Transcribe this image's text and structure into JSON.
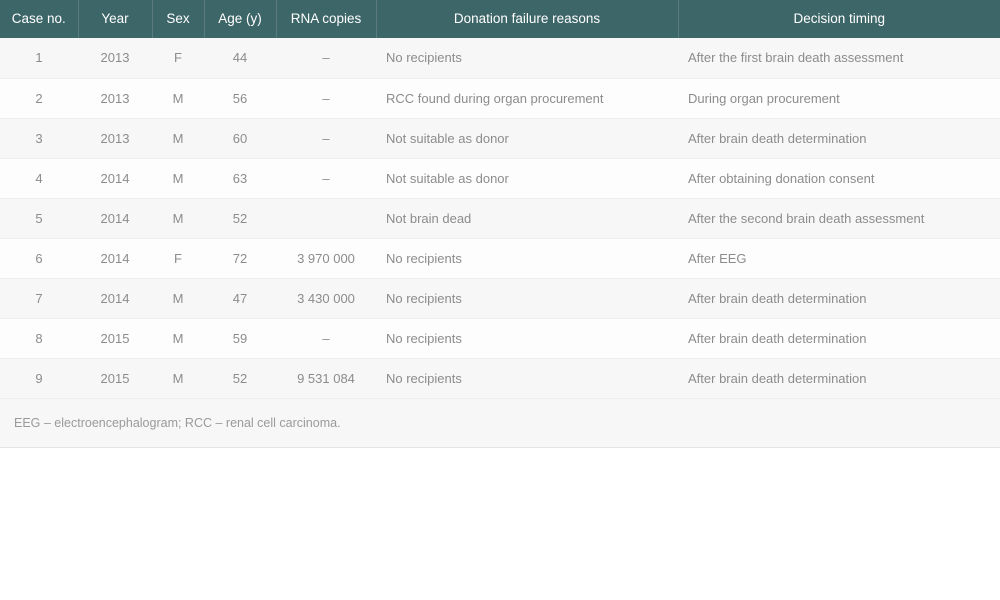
{
  "table": {
    "columns": [
      {
        "key": "case_no",
        "label": "Case no.",
        "align": "center"
      },
      {
        "key": "year",
        "label": "Year",
        "align": "center"
      },
      {
        "key": "sex",
        "label": "Sex",
        "align": "center"
      },
      {
        "key": "age",
        "label": "Age (y)",
        "align": "center"
      },
      {
        "key": "rna",
        "label": "RNA copies",
        "align": "center"
      },
      {
        "key": "reason",
        "label": "Donation failure reasons",
        "align": "center"
      },
      {
        "key": "timing",
        "label": "Decision timing",
        "align": "center"
      }
    ],
    "rows": [
      {
        "case_no": "1",
        "year": "2013",
        "sex": "F",
        "age": "44",
        "rna": "–",
        "reason": "No recipients",
        "timing": "After the first brain death assessment"
      },
      {
        "case_no": "2",
        "year": "2013",
        "sex": "M",
        "age": "56",
        "rna": "–",
        "reason": "RCC found during organ procurement",
        "timing": "During organ procurement"
      },
      {
        "case_no": "3",
        "year": "2013",
        "sex": "M",
        "age": "60",
        "rna": "–",
        "reason": "Not suitable as donor",
        "timing": "After brain death determination"
      },
      {
        "case_no": "4",
        "year": "2014",
        "sex": "M",
        "age": "63",
        "rna": "–",
        "reason": "Not suitable as donor",
        "timing": "After obtaining donation consent"
      },
      {
        "case_no": "5",
        "year": "2014",
        "sex": "M",
        "age": "52",
        "rna": "",
        "reason": "Not brain dead",
        "timing": "After the second brain death assessment"
      },
      {
        "case_no": "6",
        "year": "2014",
        "sex": "F",
        "age": "72",
        "rna": "3 970 000",
        "reason": "No recipients",
        "timing": "After EEG"
      },
      {
        "case_no": "7",
        "year": "2014",
        "sex": "M",
        "age": "47",
        "rna": "3 430 000",
        "reason": "No recipients",
        "timing": "After brain death determination"
      },
      {
        "case_no": "8",
        "year": "2015",
        "sex": "M",
        "age": "59",
        "rna": "–",
        "reason": "No recipients",
        "timing": "After brain death determination"
      },
      {
        "case_no": "9",
        "year": "2015",
        "sex": "M",
        "age": "52",
        "rna": "9 531 084",
        "reason": "No recipients",
        "timing": "After brain death determination"
      }
    ],
    "footnote": "EEG – electroencephalogram; RCC – renal cell carcinoma.",
    "colors": {
      "header_background": "#3d6668",
      "header_text": "#ffffff",
      "header_divider": "#5a7c7e",
      "row_odd_background": "#f7f7f7",
      "row_even_background": "#fdfdfd",
      "row_border": "#eeeeee",
      "body_text": "#8c8c8c",
      "footnote_background": "#f7f7f7",
      "footnote_text": "#9a9a9a"
    }
  }
}
